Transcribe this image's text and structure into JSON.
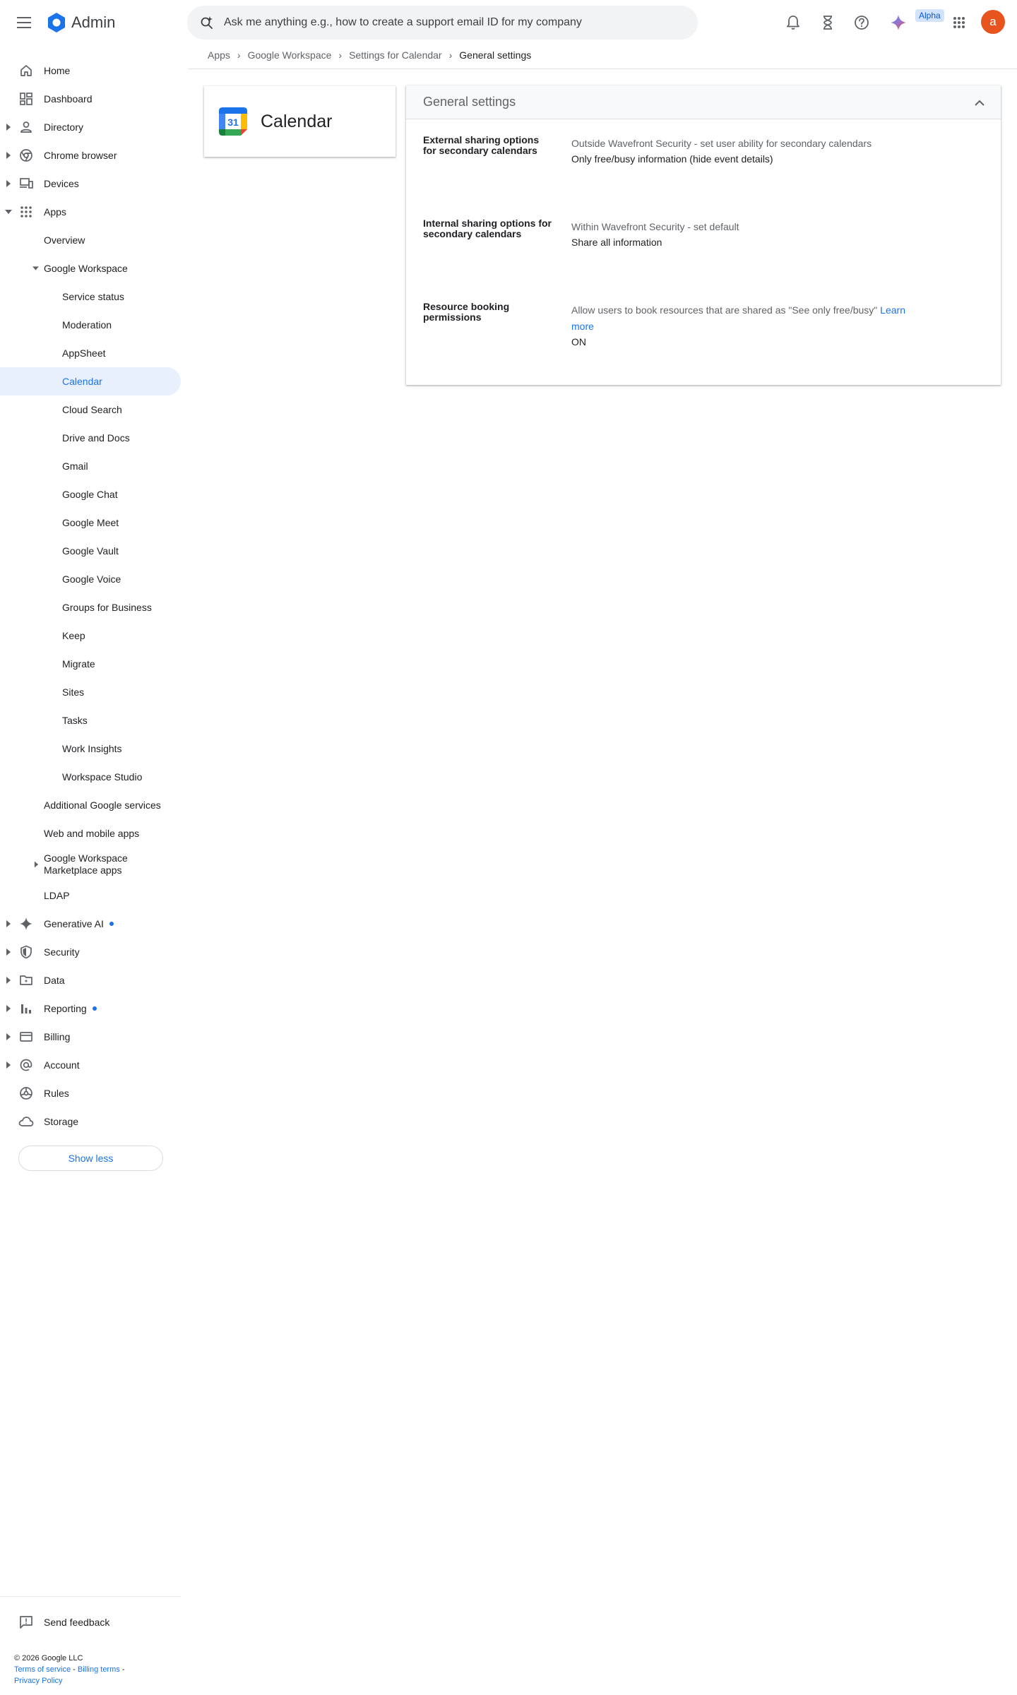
{
  "header": {
    "app_name": "Admin",
    "search_placeholder": "Ask me anything e.g., how to create a support email ID for my company",
    "alpha_badge": "Alpha",
    "avatar_letter": "a"
  },
  "sidebar": {
    "items": [
      {
        "label": "Home"
      },
      {
        "label": "Dashboard"
      },
      {
        "label": "Directory"
      },
      {
        "label": "Chrome browser"
      },
      {
        "label": "Devices"
      },
      {
        "label": "Apps"
      },
      {
        "label": "Overview"
      },
      {
        "label": "Google Workspace"
      },
      {
        "label": "Service status"
      },
      {
        "label": "Moderation"
      },
      {
        "label": "AppSheet"
      },
      {
        "label": "Calendar"
      },
      {
        "label": "Cloud Search"
      },
      {
        "label": "Drive and Docs"
      },
      {
        "label": "Gmail"
      },
      {
        "label": "Google Chat"
      },
      {
        "label": "Google Meet"
      },
      {
        "label": "Google Vault"
      },
      {
        "label": "Google Voice"
      },
      {
        "label": "Groups for Business"
      },
      {
        "label": "Keep"
      },
      {
        "label": "Migrate"
      },
      {
        "label": "Sites"
      },
      {
        "label": "Tasks"
      },
      {
        "label": "Work Insights"
      },
      {
        "label": "Workspace Studio"
      },
      {
        "label": "Additional Google services"
      },
      {
        "label": "Web and mobile apps"
      },
      {
        "label": "Google Workspace Marketplace apps"
      },
      {
        "label": "LDAP"
      },
      {
        "label": "Generative AI"
      },
      {
        "label": "Security"
      },
      {
        "label": "Data"
      },
      {
        "label": "Reporting"
      },
      {
        "label": "Billing"
      },
      {
        "label": "Account"
      },
      {
        "label": "Rules"
      },
      {
        "label": "Storage"
      }
    ],
    "show_less": "Show less",
    "send_feedback": "Send feedback",
    "footer": {
      "copyright": "© 2026 Google LLC",
      "terms": "Terms of service",
      "billing_terms": "Billing terms",
      "privacy": "Privacy Policy",
      "sep": " - "
    }
  },
  "breadcrumb": [
    "Apps",
    "Google Workspace",
    "Settings for Calendar",
    "General settings"
  ],
  "app_card": {
    "title": "Calendar",
    "icon_text": "31"
  },
  "panel": {
    "title": "General settings",
    "settings": [
      {
        "label": "External sharing options for secondary calendars",
        "description": "Outside Wavefront Security - set user ability for secondary calendars",
        "value": "Only free/busy information (hide event details)"
      },
      {
        "label": "Internal sharing options for secondary calendars",
        "description": "Within Wavefront Security - set default",
        "value": "Share all information"
      },
      {
        "label": "Resource booking permissions",
        "description": "Allow users to book resources that are shared as \"See only free/busy\"",
        "link": "Learn more",
        "value": "ON"
      }
    ]
  },
  "colors": {
    "accent": "#1a73e8",
    "active_bg": "#e8f0fe",
    "avatar": "#e8541e"
  },
  "icons": {
    "menu": "hamburger-menu-icon",
    "search": "search-spark-icon",
    "notifications": "bell-icon",
    "tasks": "hourglass-icon",
    "help": "help-icon",
    "gemini": "gemini-spark-icon",
    "apps": "apps-grid-icon"
  }
}
